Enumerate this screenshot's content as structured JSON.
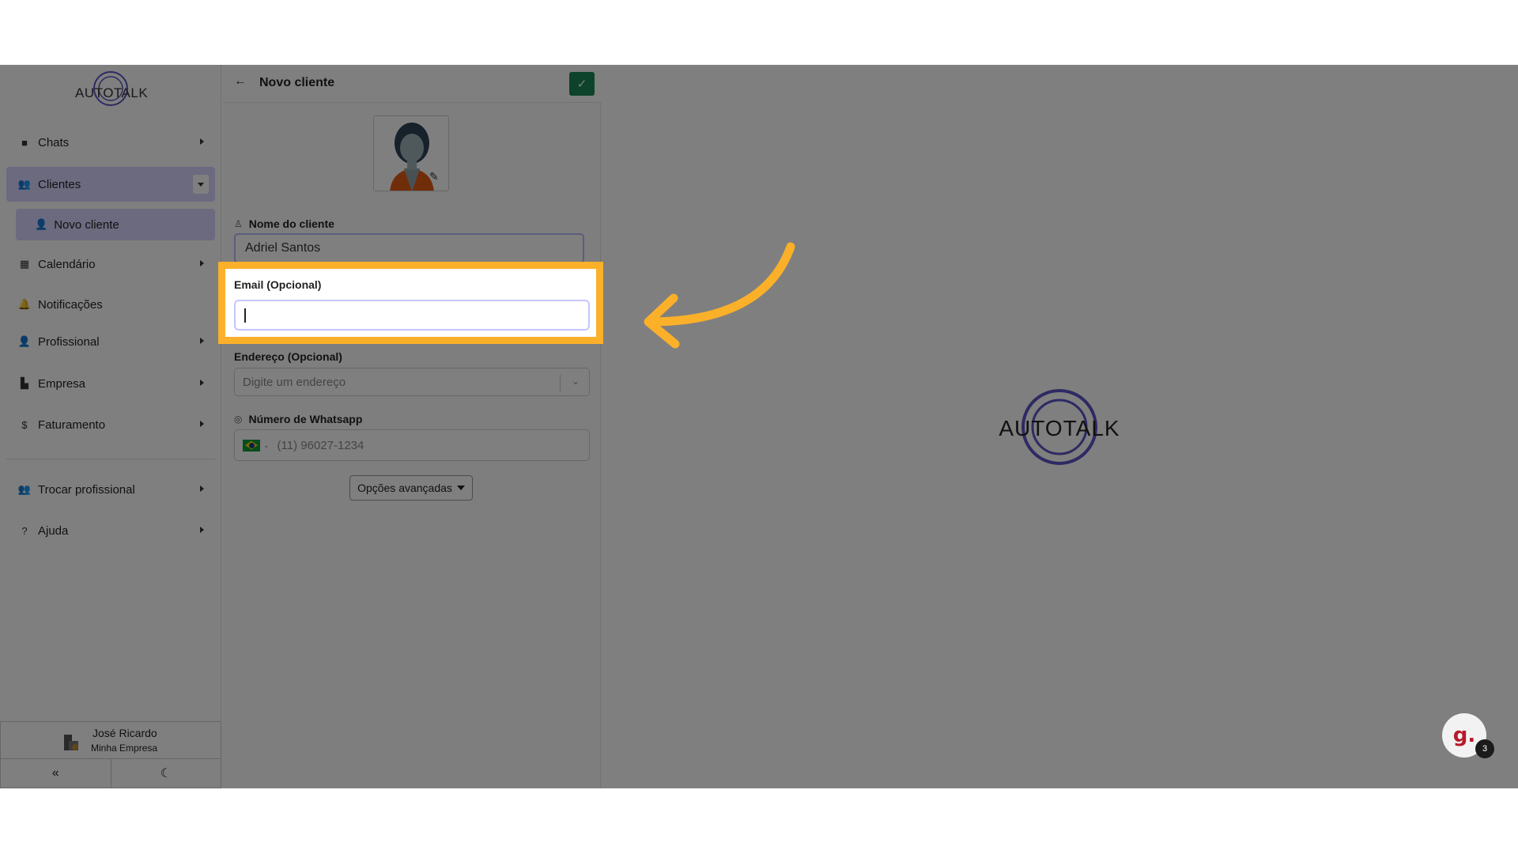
{
  "sidebar": {
    "logo_text": "AUTOTALK",
    "items": [
      {
        "label": "Chats"
      },
      {
        "label": "Clientes"
      },
      {
        "label": "Novo cliente"
      },
      {
        "label": "Calendário"
      },
      {
        "label": "Notificações"
      },
      {
        "label": "Profissional"
      },
      {
        "label": "Empresa"
      },
      {
        "label": "Faturamento"
      },
      {
        "label": "Trocar profissional"
      },
      {
        "label": "Ajuda"
      }
    ],
    "user": {
      "name": "José Ricardo",
      "company": "Minha Empresa"
    }
  },
  "panel": {
    "title": "Novo cliente",
    "name_label": "Nome do cliente",
    "name_value": "Adriel Santos",
    "email_label": "Email (Opcional)",
    "address_label": "Endereço (Opcional)",
    "address_placeholder": "Digite um endereço",
    "whatsapp_label": "Número de Whatsapp",
    "whatsapp_placeholder": "(11) 96027-1234",
    "advanced_button": "Opções avançadas"
  },
  "main": {
    "logo_text": "AUTOTALK"
  },
  "chat_widget": {
    "glyph": "g.",
    "badge_count": "3"
  },
  "colors": {
    "accent": "#d6d5ff",
    "highlight": "#fbb02a",
    "save": "#198754",
    "logo_ring": "#5b55c7"
  }
}
